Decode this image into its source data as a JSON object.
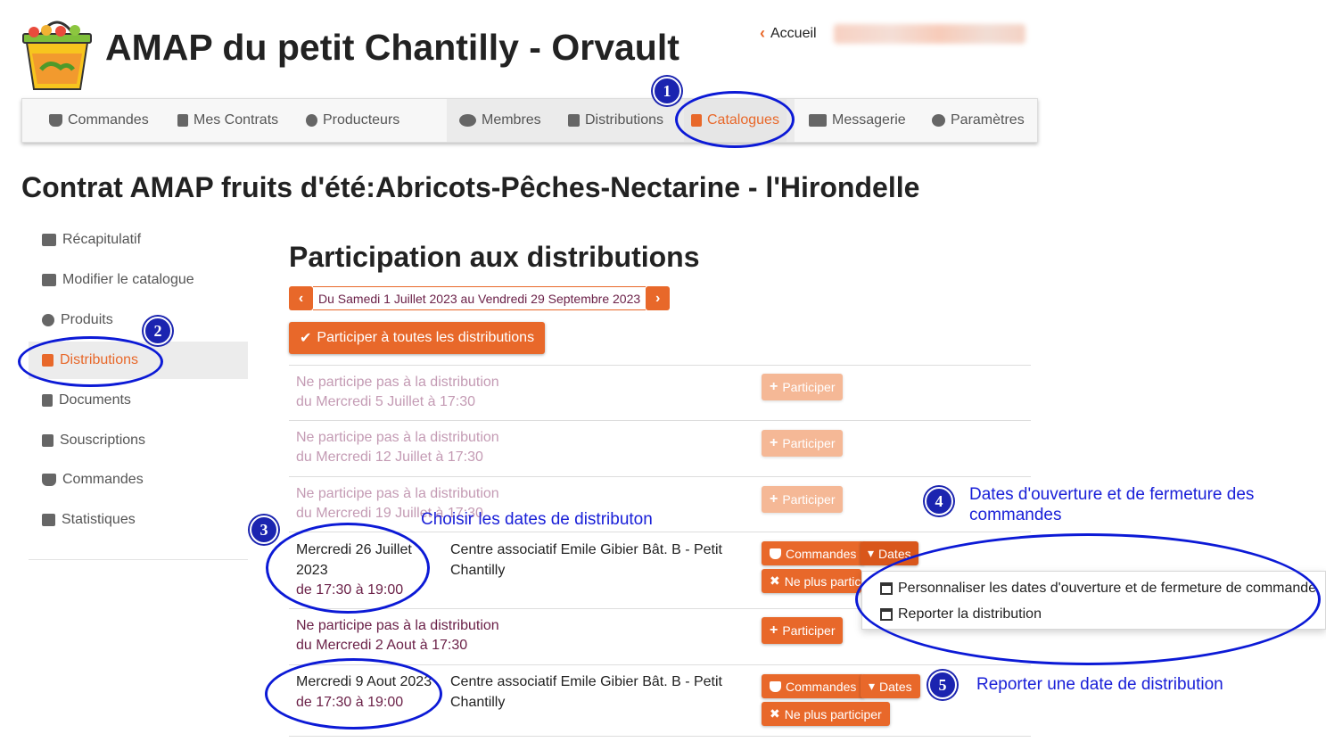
{
  "header": {
    "site_title": "AMAP du petit Chantilly - Orvault",
    "home_link": "Accueil"
  },
  "navbar": {
    "items": [
      {
        "label": "Commandes",
        "icon": "basket-icon"
      },
      {
        "label": "Mes Contrats",
        "icon": "book-icon"
      },
      {
        "label": "Producteurs",
        "icon": "farmer-icon"
      },
      {
        "label": "Membres",
        "icon": "users-icon"
      },
      {
        "label": "Distributions",
        "icon": "calendar-icon"
      },
      {
        "label": "Catalogues",
        "icon": "book-icon",
        "active": true
      },
      {
        "label": "Messagerie",
        "icon": "envelope-icon"
      },
      {
        "label": "Paramètres",
        "icon": "gear-icon"
      }
    ]
  },
  "page_title": "Contrat AMAP fruits d'été:Abricots-Pêches-Nectarine - l'Hirondelle",
  "sidebar": {
    "items": [
      {
        "label": "Récapitulatif",
        "icon": "home-icon"
      },
      {
        "label": "Modifier le catalogue",
        "icon": "edit-icon"
      },
      {
        "label": "Produits",
        "icon": "apple-icon"
      },
      {
        "label": "Distributions",
        "icon": "calendar-icon",
        "active": true
      },
      {
        "label": "Documents",
        "icon": "pdf-icon"
      },
      {
        "label": "Souscriptions",
        "icon": "calendar-check-icon"
      },
      {
        "label": "Commandes",
        "icon": "basket-icon"
      },
      {
        "label": "Statistiques",
        "icon": "chart-icon"
      }
    ]
  },
  "main": {
    "title": "Participation aux distributions",
    "period": "Du Samedi 1 Juillet 2023 au Vendredi 29 Septembre 2023",
    "participate_all": "Participer à toutes les distributions",
    "not_participating": "Ne participe pas à la distribution",
    "participate": "Participer",
    "orders": "Commandes",
    "dates": "Dates",
    "stop_participating": "Ne plus participer",
    "stop_participating_cut": "Ne plus partici",
    "distributions": [
      {
        "date": "du Mercredi 5 Juillet à 17:30"
      },
      {
        "date": "du Mercredi 12 Juillet à 17:30"
      },
      {
        "date": "du Mercredi 19 Juillet à 17:30"
      },
      {
        "day_line1": "Mercredi 26 Juillet",
        "day_line2": "2023",
        "time": "de 17:30 à 19:00",
        "place_line1": "Centre associatif Emile Gibier Bât. B - Petit",
        "place_line2": "Chantilly"
      },
      {
        "date": "du Mercredi 2 Aout à 17:30"
      },
      {
        "day_line1": "Mercredi 9 Aout 2023",
        "time": "de 17:30 à 19:00",
        "place_line1": "Centre associatif Emile Gibier Bât. B - Petit",
        "place_line2": "Chantilly"
      }
    ],
    "dropdown": {
      "customize": "Personnaliser les dates d'ouverture et de fermeture de commande",
      "postpone": "Reporter la distribution"
    }
  },
  "annotations": {
    "badges": [
      "1",
      "2",
      "3",
      "4",
      "5"
    ],
    "note_choose": "Choisir les dates de distributon",
    "note_open_close_line1": "Dates d'ouverture et de fermeture des",
    "note_open_close_line2": "commandes",
    "note_postpone": "Reporter une date de distribution",
    "color": "#1b24b0"
  },
  "colors": {
    "accent": "#e8682a",
    "accent_pale": "#f5b896",
    "date_text": "#6b2148"
  }
}
